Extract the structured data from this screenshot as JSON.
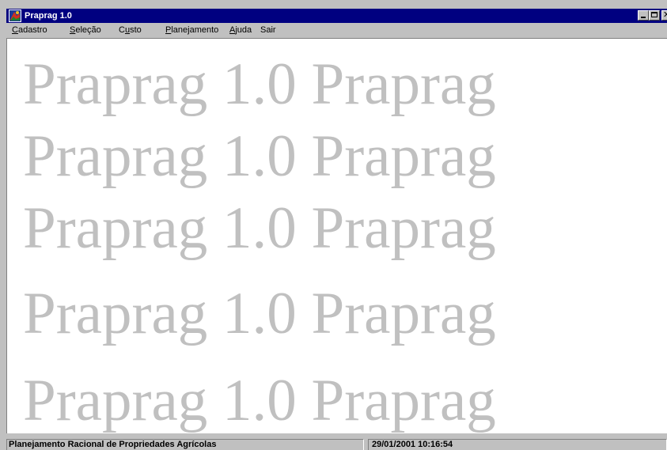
{
  "window": {
    "title": "Praprag 1.0",
    "icon": "app-logo-icon",
    "controls": {
      "minimize_icon": "minimize-icon",
      "maximize_icon": "maximize-icon",
      "close_icon": "close-icon",
      "close_glyph": "✕"
    },
    "colors": {
      "title_bar": "#000080",
      "chrome": "#c0c0c0",
      "watermark": "#c0c0c0"
    }
  },
  "menu": {
    "items": [
      {
        "accel": "C",
        "rest": "adastro"
      },
      {
        "accel": "S",
        "rest": "eleção"
      },
      {
        "pre": "C",
        "accel": "u",
        "rest": "sto"
      },
      {
        "accel": "P",
        "rest": "lanejamento"
      },
      {
        "accel": "A",
        "rest": "juda"
      },
      {
        "accel": "",
        "rest": "Sair"
      }
    ]
  },
  "watermark": {
    "rows": [
      "Praprag 1.0 Praprag",
      "Praprag 1.0 Praprag",
      "Praprag 1.0 Praprag",
      "Praprag 1.0 Praprag",
      "Praprag 1.0 Praprag"
    ]
  },
  "status_bar": {
    "app_name": "Planejamento Racional de Propriedades Agrícolas",
    "datetime": "29/01/2001 10:16:54"
  }
}
